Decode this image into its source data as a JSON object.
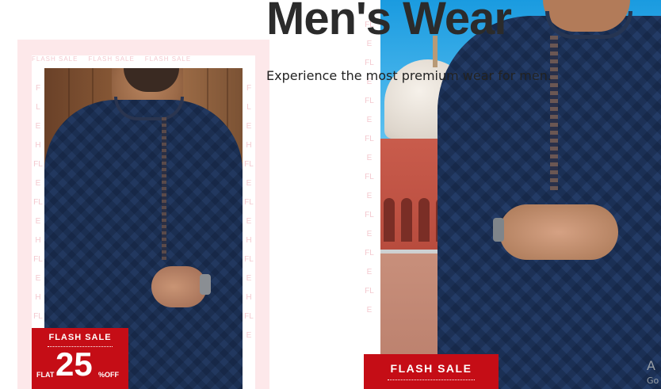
{
  "hero": {
    "title": "Men's Wear",
    "subtitle": "Experience the most premium wear for men."
  },
  "left_promo": {
    "watermark_text": "FLASH SALE",
    "badge": {
      "title": "FLASH SALE",
      "flat": "FLAT",
      "percent": "25",
      "off": "%OFF"
    }
  },
  "right_promo": {
    "badge": {
      "title": "FLASH SALE"
    }
  },
  "watermark_letters_left": [
    "F",
    "L",
    "E",
    "H",
    "FL",
    "E",
    "FL",
    "E",
    "H",
    "FL",
    "E",
    "H",
    "FL",
    "E"
  ],
  "watermark_letters_mid": [
    "FL",
    "E",
    "FL",
    "E",
    "FL",
    "E",
    "FL",
    "E",
    "FL",
    "E",
    "FL",
    "E",
    "FL",
    "E",
    "FL",
    "E"
  ],
  "corner": {
    "text": "A",
    "sub": "Go"
  },
  "colors": {
    "sale_red": "#c50d16",
    "pink_bg": "#fde8ea",
    "navy": "#1f3458"
  }
}
